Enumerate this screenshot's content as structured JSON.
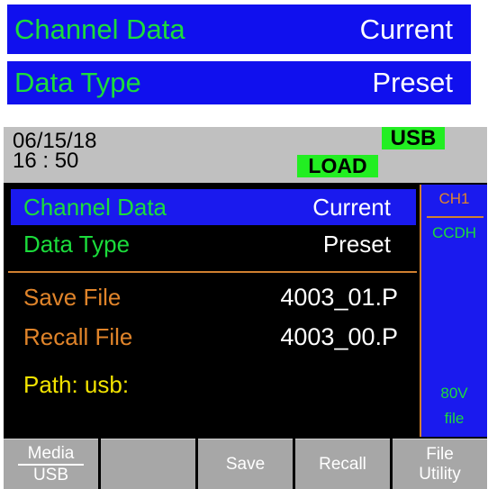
{
  "callouts": [
    {
      "key": "Channel Data",
      "value": "Current"
    },
    {
      "key": "Data Type",
      "value": "Preset"
    }
  ],
  "status": {
    "date": "06/15/18",
    "time": "16 : 50",
    "usb_badge": "USB",
    "load_badge": "LOAD"
  },
  "menu": {
    "channel_data": {
      "label": "Channel Data",
      "value": "Current"
    },
    "data_type": {
      "label": "Data Type",
      "value": "Preset"
    },
    "save_file": {
      "label": "Save File",
      "value": "4003_01.P"
    },
    "recall_file": {
      "label": "Recall File",
      "value": "4003_00.P"
    },
    "path": "Path:  usb:"
  },
  "side": {
    "channel": "CH1",
    "mode": "CCDH",
    "voltage": "80V",
    "file": "file"
  },
  "softkeys": {
    "media_top": "Media",
    "media_bottom": "USB",
    "blank": "",
    "save": "Save",
    "recall": "Recall",
    "file_top": "File",
    "file_bottom": "Utility"
  },
  "colors": {
    "selection": "#1a1aee",
    "key_text": "#1bdc3b",
    "file_text": "#e0842a",
    "path_text": "#f2e300",
    "badge": "#22ee22"
  }
}
